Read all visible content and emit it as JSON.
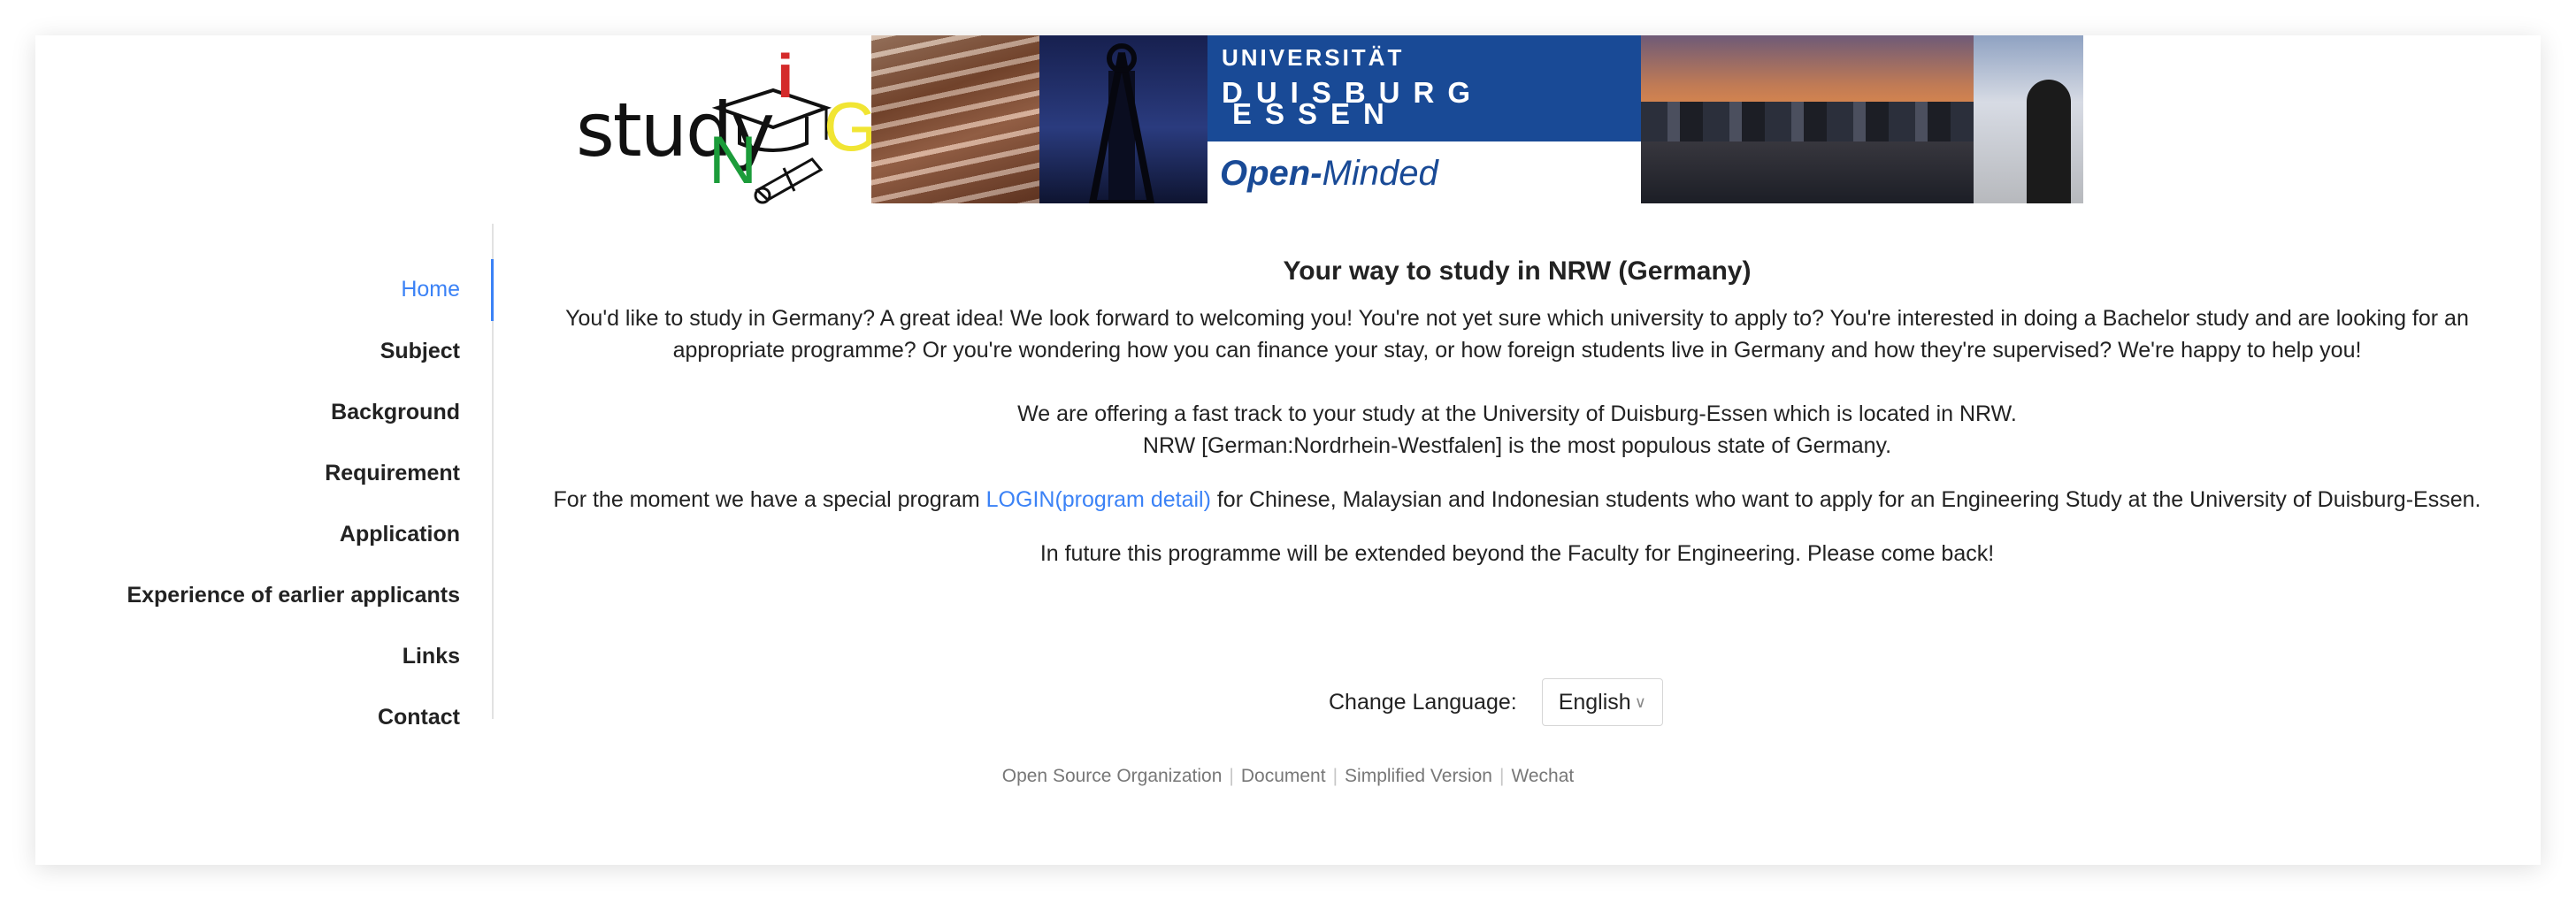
{
  "logo": {
    "word": "study",
    "letter_i": "i",
    "letter_n": "N",
    "letter_g": "G"
  },
  "banner": {
    "line1": "UNIVERSITÄT",
    "line2": "DUISBURG",
    "line3": "ESSEN",
    "slogan_bold": "Open-",
    "slogan_rest": "Minded"
  },
  "sidebar": {
    "items": [
      {
        "label": "Home",
        "active": true
      },
      {
        "label": "Subject"
      },
      {
        "label": "Background"
      },
      {
        "label": "Requirement"
      },
      {
        "label": "Application"
      },
      {
        "label": "Experience of earlier applicants"
      },
      {
        "label": "Links"
      },
      {
        "label": "Contact"
      }
    ]
  },
  "main": {
    "title": "Your way to study in NRW (Germany)",
    "intro_line1": "You'd like to study in Germany? A great idea! We look forward to welcoming you! You're not yet sure which university to apply to? You're interested in doing a Bachelor study and are looking for an",
    "intro_line2": "appropriate programme? Or you're wondering how you can finance your stay, or how foreign students live in Germany and how they're supervised? We're happy to help you!",
    "offer_line1": "We are offering a fast track to your study at the University of Duisburg-Essen which is located in NRW.",
    "offer_line2": "NRW [German:Nordrhein-Westfalen] is the most populous state of Germany.",
    "special_before": "For the moment we have a special program ",
    "special_link": "LOGIN(program detail)",
    "special_after": " for Chinese, Malaysian and Indonesian students who want to apply for an Engineering Study at the University of Duisburg-Essen.",
    "future": "In future this programme will be extended beyond the Faculty for Engineering. Please come back!"
  },
  "language": {
    "label": "Change Language:",
    "selected": "English"
  },
  "footer": {
    "links": [
      "Open Source Organization",
      "Document",
      "Simplified Version",
      "Wechat"
    ],
    "separator": "|"
  },
  "colors": {
    "accent": "#3b82f6",
    "ude_blue": "#194a96"
  }
}
